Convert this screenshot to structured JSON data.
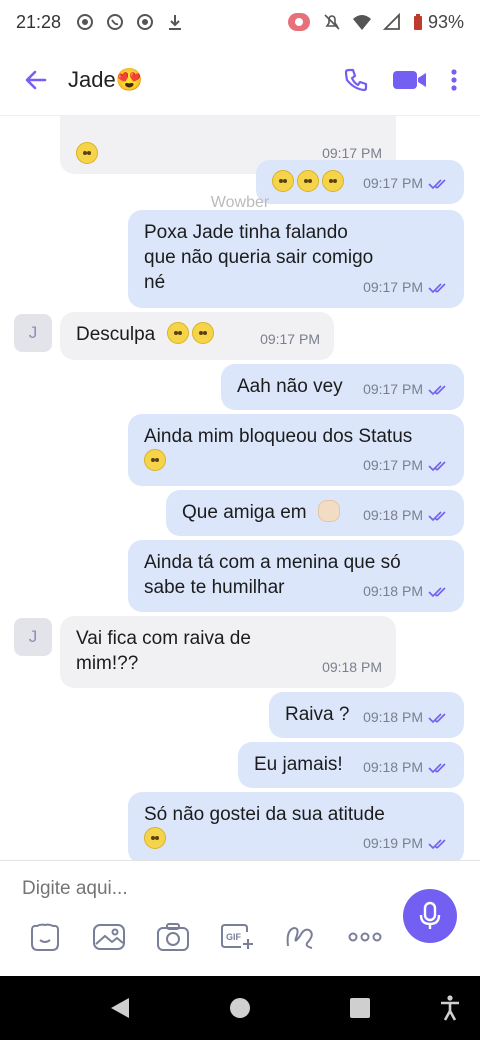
{
  "status_bar": {
    "time": "21:28",
    "battery": "93%"
  },
  "header": {
    "contact_name": "Jade😍"
  },
  "watermark": "Wowber",
  "messages": [
    {
      "dir": "in",
      "text": "",
      "emojis": [
        "grimace"
      ],
      "time": "09:17 PM"
    },
    {
      "dir": "out",
      "text": "",
      "emojis": [
        "eyeroll",
        "eyeroll",
        "eyeroll"
      ],
      "time": "09:17 PM"
    },
    {
      "dir": "out",
      "text": "Poxa Jade tinha falando\nque não queria sair comigo\nné",
      "time": "09:17 PM"
    },
    {
      "dir": "in",
      "text": "Desculpa",
      "emojis": [
        "grimace",
        "pleading"
      ],
      "time": "09:17 PM",
      "avatar": "J"
    },
    {
      "dir": "out",
      "text": "Aah não vey",
      "time": "09:17 PM"
    },
    {
      "dir": "out",
      "text": "Ainda mim bloqueou dos Status",
      "emojis": [
        "eyeroll"
      ],
      "time": "09:17 PM"
    },
    {
      "dir": "out",
      "text": "Que amiga em",
      "emojis": [
        "clap"
      ],
      "time": "09:18 PM"
    },
    {
      "dir": "out",
      "text": "Ainda tá com a menina que só\nsabe te humilhar",
      "time": "09:18 PM"
    },
    {
      "dir": "in",
      "text": "Vai fica com raiva de\nmim!??",
      "time": "09:18 PM",
      "avatar": "J"
    },
    {
      "dir": "out",
      "text": "Raiva ?",
      "time": "09:18 PM"
    },
    {
      "dir": "out",
      "text": "Eu jamais!",
      "time": "09:18 PM"
    },
    {
      "dir": "out",
      "text": "Só não gostei da sua atitude",
      "emojis": [
        "eyeroll"
      ],
      "time": "09:19 PM"
    }
  ],
  "composer": {
    "placeholder": "Digite aqui..."
  },
  "colors": {
    "accent": "#7360f2",
    "outgoing": "#dbe6fb",
    "incoming": "#f1f1f3"
  }
}
